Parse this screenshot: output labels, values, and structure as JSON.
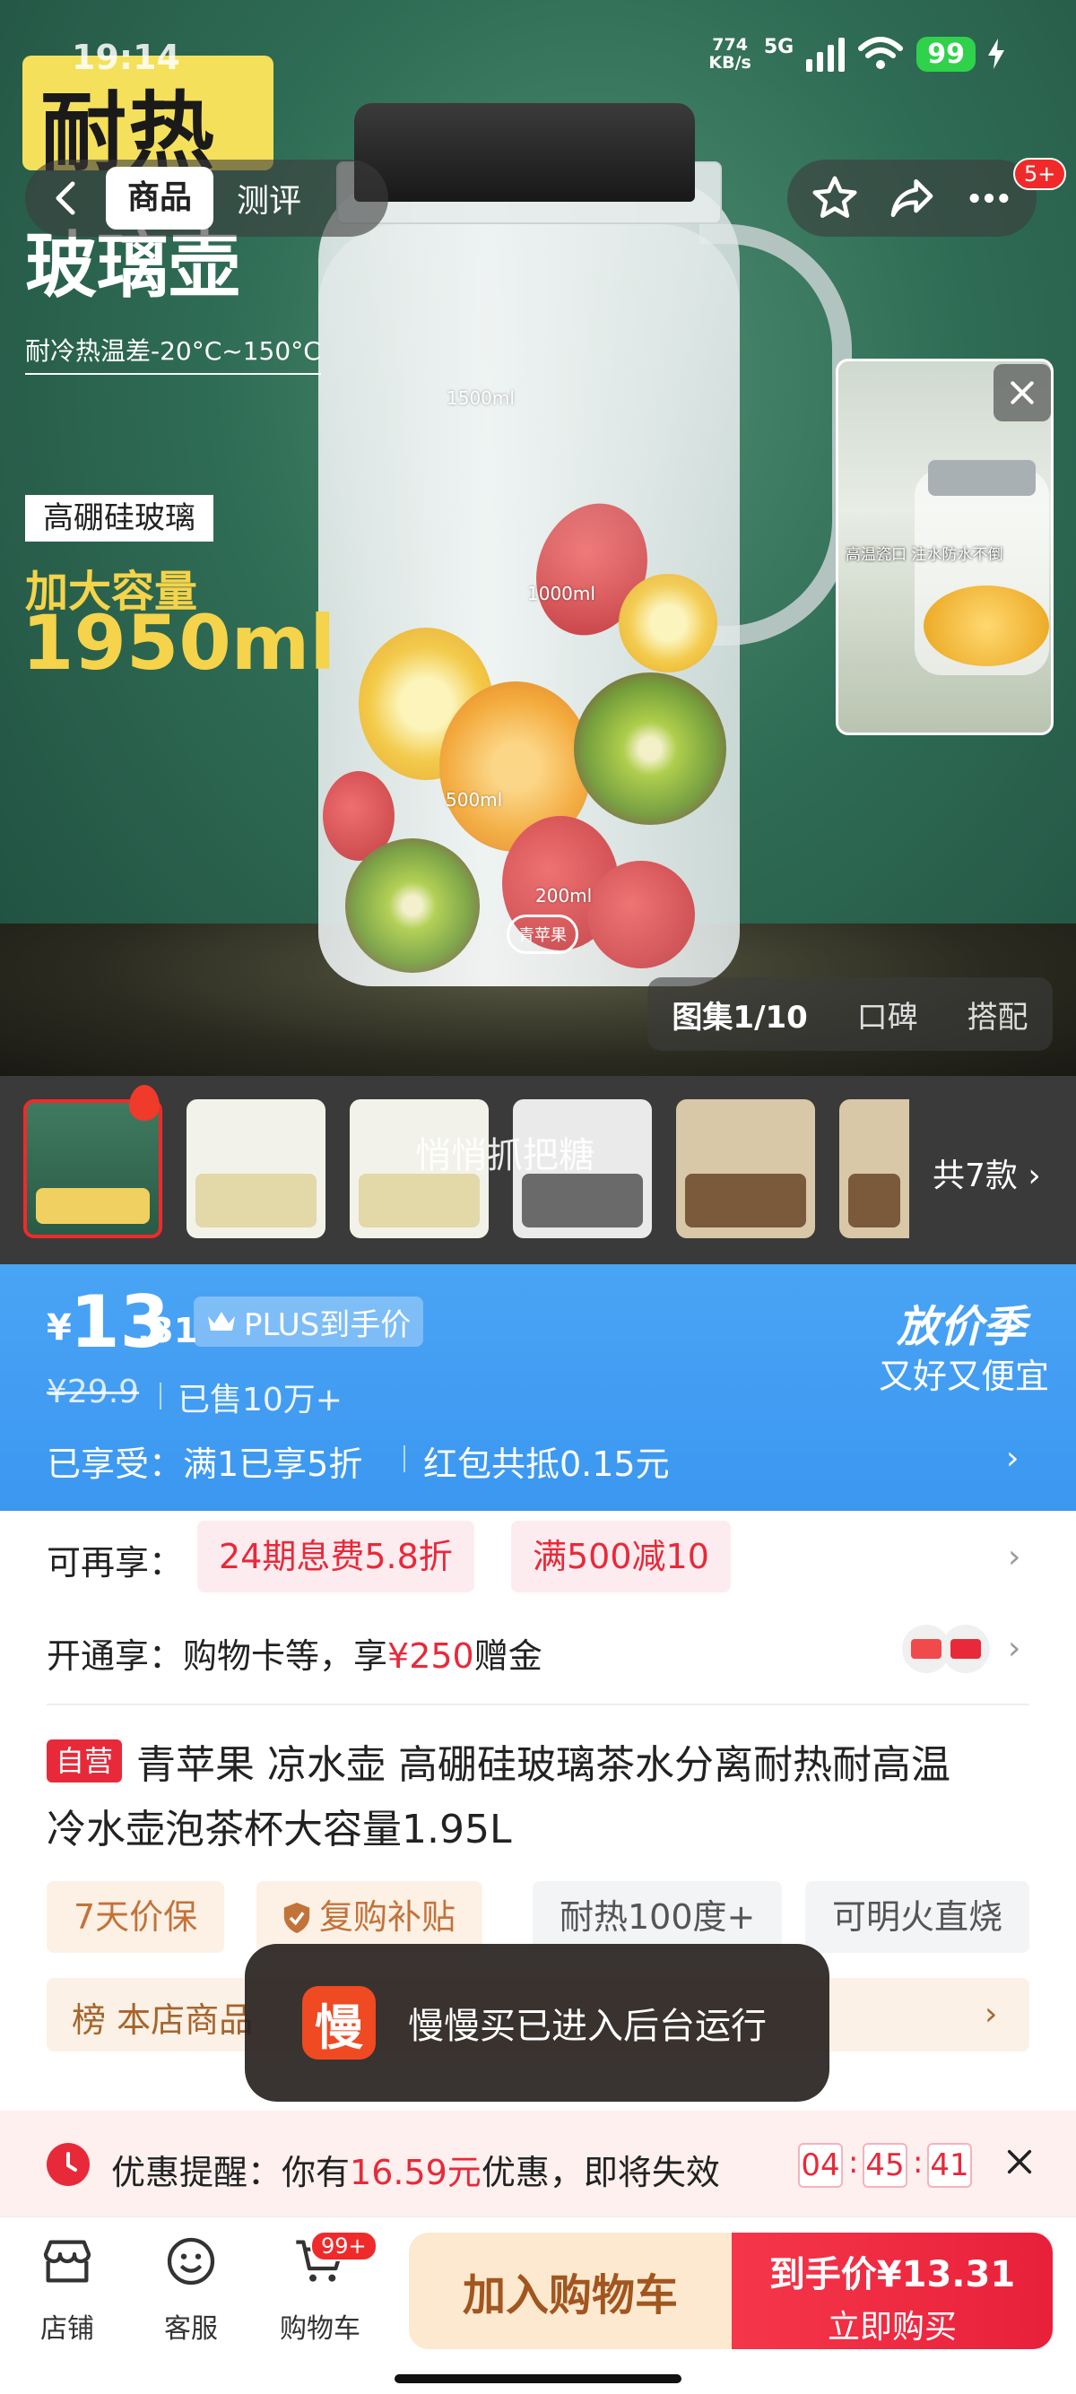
{
  "status_bar": {
    "time": "19:14",
    "net_speed_top": "774",
    "net_speed_unit": "KB/s",
    "network": "5G",
    "battery": "99"
  },
  "nav": {
    "tab_goods": "商品",
    "tab_review": "测评",
    "message_badge": "5+"
  },
  "hero": {
    "headline1": "耐热",
    "headline2": "玻璃壶",
    "temp_text": "耐冷热温差-20°C~150°C",
    "material": "高硼硅玻璃",
    "capacity_label": "加大容量",
    "capacity_value": "1950ml",
    "marks": [
      "1500ml",
      "1000ml",
      "500ml",
      "200ml"
    ],
    "jug_logo": "青苹果",
    "video_text": "高温瓷口 注水防水不倒",
    "gallery_tabs": [
      "图集1/10",
      "口碑",
      "搭配"
    ]
  },
  "thumbs": {
    "watermark": "悄悄抓把糖",
    "more": "共7款"
  },
  "price": {
    "yen": "¥",
    "integer": "13",
    "decimal": ".31",
    "plus_label": "PLUS到手价",
    "original": "¥29.9",
    "sold": "已售10万+",
    "season_title": "放价季",
    "season_sub": "又好又便宜",
    "enjoyed": "已享受：满1已享5折",
    "red_packet": "红包共抵0.15元"
  },
  "offers": {
    "more_label": "可再享：",
    "coupons": [
      "24期息费5.8折",
      "满500减10"
    ],
    "open_label": "开通享：购物卡等，享",
    "open_amount": "¥250",
    "open_suffix": "赠金"
  },
  "product": {
    "self_tag": "自营",
    "title_line1": "青苹果 凉水壶 高硼硅玻璃茶水分离耐热耐高温",
    "title_line2": "冷水壶泡茶杯大容量1.95L",
    "features": [
      "7天价保",
      "复购补贴",
      "耐热100度+",
      "可明火直烧"
    ],
    "rank": "榜 本店商品"
  },
  "toast": {
    "icon_text": "慢",
    "message": "慢慢买已进入后台运行"
  },
  "reminder": {
    "label": "优惠提醒：你有",
    "amount": "16.59元",
    "suffix": "优惠，即将失效",
    "hours": "04",
    "minutes": "45",
    "seconds": "41"
  },
  "bottom_bar": {
    "shop": "店铺",
    "service": "客服",
    "cart": "购物车",
    "cart_badge": "99+",
    "add_to_cart": "加入购物车",
    "buy_line1": "到手价¥13.31",
    "buy_line2": "立即购买"
  },
  "colors": {
    "accent_red": "#e8293a",
    "price_blue": "#3b97f0",
    "cart_button": "#fde9cf"
  }
}
